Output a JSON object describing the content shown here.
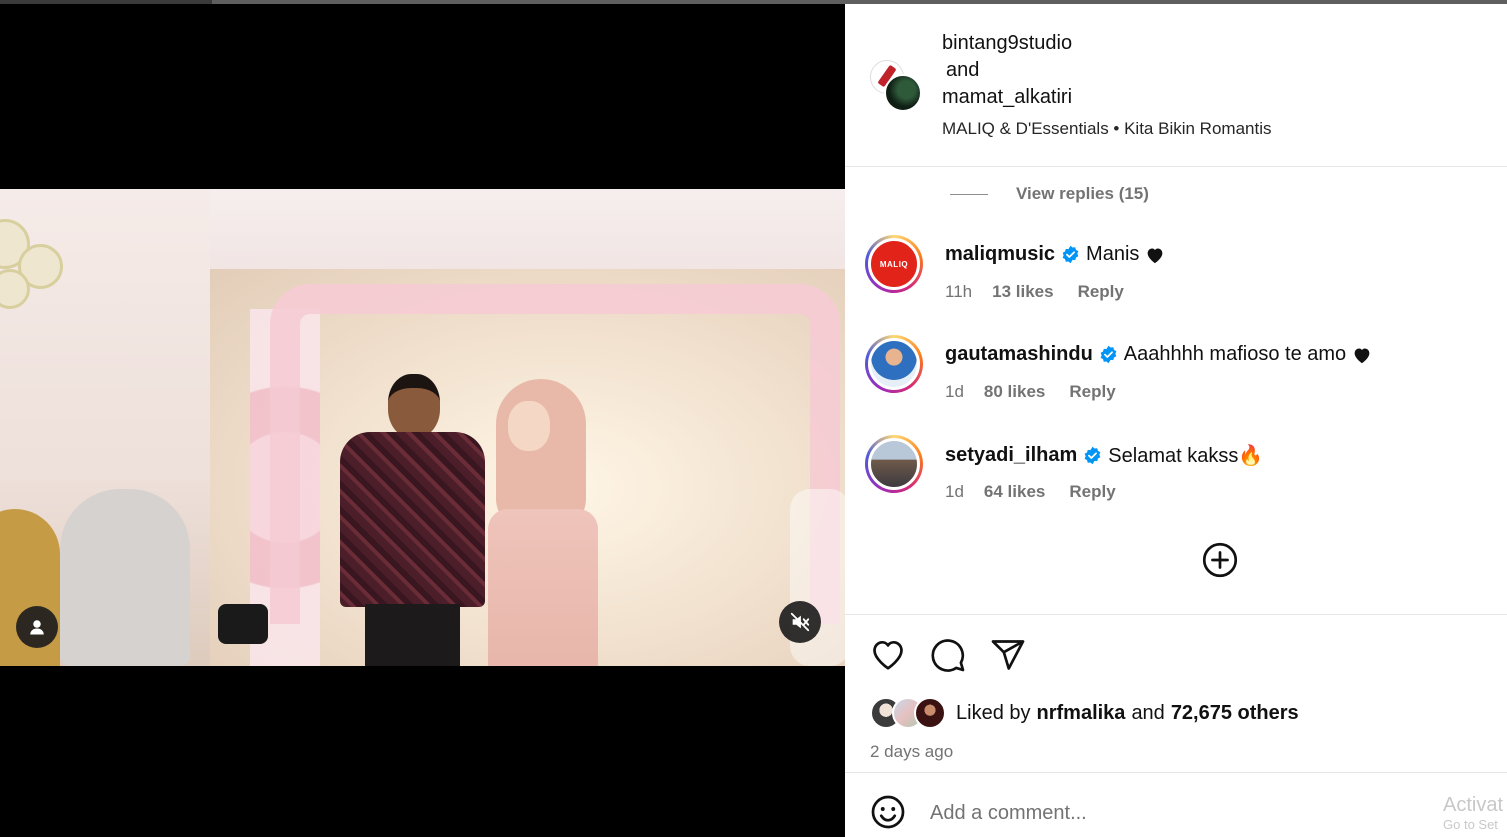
{
  "post": {
    "author_primary": "bintang9studio",
    "join_word": "and",
    "author_secondary": "mamat_alkatiri",
    "audio": "MALIQ & D'Essentials • Kita Bikin Romantis"
  },
  "thread": {
    "view_replies": "View replies (15)"
  },
  "comments": [
    {
      "user": "maliqmusic",
      "text": "Manis",
      "time": "11h",
      "likes": "13 likes",
      "reply": "Reply",
      "avatar_text": "MALIQ"
    },
    {
      "user": "gautamashindu",
      "text": "Aaahhhh mafioso te amo",
      "time": "1d",
      "likes": "80 likes",
      "reply": "Reply"
    },
    {
      "user": "setyadi_ilham",
      "text": "Selamat kakss🔥",
      "time": "1d",
      "likes": "64 likes",
      "reply": "Reply"
    }
  ],
  "engagement": {
    "liked_prefix": "Liked by",
    "liked_user": "nrfmalika",
    "liked_and": "and",
    "liked_others": "72,675 others",
    "posted": "2 days ago"
  },
  "composer": {
    "placeholder": "Add a comment..."
  },
  "watermark": {
    "line1": "Activat",
    "line2": "Go to Set"
  },
  "icons": {
    "user_tag": "user-icon",
    "mute": "speaker-muted-icon",
    "verified": "verified-badge-icon",
    "heart": "heart-icon",
    "add": "plus-circle-icon",
    "like": "heart-outline-icon",
    "comment": "speech-bubble-icon",
    "share": "paper-plane-icon",
    "emoji": "smiley-icon"
  },
  "colors": {
    "verified": "#0095f6",
    "muted_text": "#737373"
  }
}
